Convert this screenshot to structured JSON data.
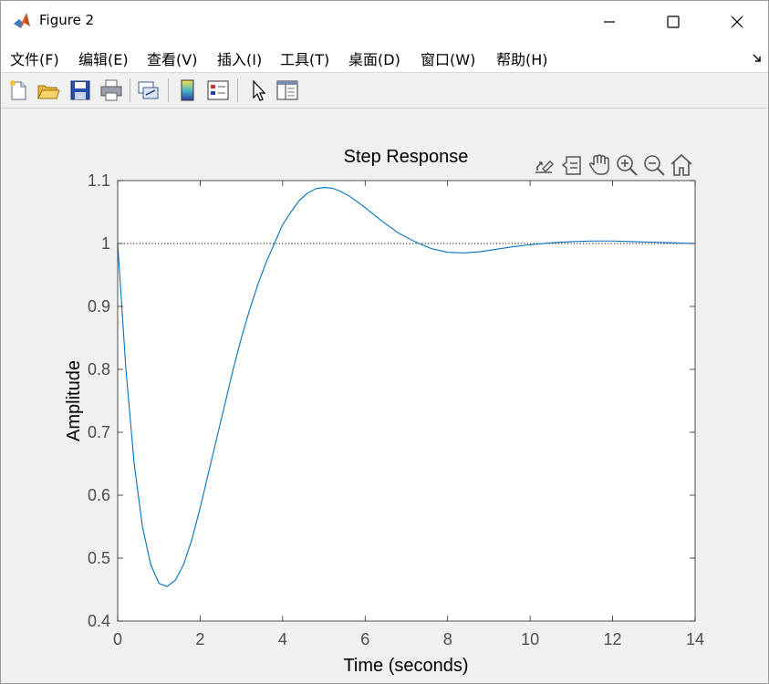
{
  "window": {
    "title": "Figure 2",
    "controls": [
      "minimize",
      "maximize",
      "close"
    ]
  },
  "menubar": {
    "items": [
      {
        "label": "文件(F)"
      },
      {
        "label": "编辑(E)"
      },
      {
        "label": "查看(V)"
      },
      {
        "label": "插入(I)"
      },
      {
        "label": "工具(T)"
      },
      {
        "label": "桌面(D)"
      },
      {
        "label": "窗口(W)"
      },
      {
        "label": "帮助(H)"
      }
    ]
  },
  "toolbar": {
    "buttons": [
      "new-figure-icon",
      "open-file-icon",
      "save-icon",
      "print-icon",
      "link-plot-icon",
      "colorbar-icon",
      "legend-icon",
      "pointer-icon",
      "property-inspector-icon"
    ]
  },
  "axes_toolbar": {
    "buttons": [
      "export-icon",
      "data-tips-icon",
      "pan-hand-icon",
      "zoom-in-icon",
      "zoom-out-icon",
      "home-icon"
    ]
  },
  "colors": {
    "line": "#0072bd",
    "axis": "#262626",
    "tick_label": "#4d4d4d",
    "background": "#f0f0f0"
  },
  "chart_data": {
    "type": "line",
    "title": "Step Response",
    "xlabel": "Time (seconds)",
    "ylabel": "Amplitude",
    "xlim": [
      0,
      14
    ],
    "ylim": [
      0.4,
      1.1
    ],
    "xticks": [
      0,
      2,
      4,
      6,
      8,
      10,
      12,
      14
    ],
    "yticks": [
      0.4,
      0.5,
      0.6,
      0.7,
      0.8,
      0.9,
      1,
      1.1
    ],
    "xtick_labels": [
      "0",
      "2",
      "4",
      "6",
      "8",
      "10",
      "12",
      "14"
    ],
    "ytick_labels": [
      "0.4",
      "0.5",
      "0.6",
      "0.7",
      "0.8",
      "0.9",
      "1",
      "1.1"
    ],
    "grid": false,
    "reference_line": {
      "y": 1,
      "style": "dotted"
    },
    "series": [
      {
        "x": [
          0,
          0.2,
          0.4,
          0.6,
          0.8,
          1.0,
          1.2,
          1.4,
          1.6,
          1.8,
          2.0,
          2.2,
          2.4,
          2.6,
          2.8,
          3.0,
          3.2,
          3.4,
          3.6,
          3.8,
          4.0,
          4.2,
          4.4,
          4.6,
          4.8,
          5.0,
          5.2,
          5.4,
          5.6,
          5.8,
          6.0,
          6.4,
          6.8,
          7.2,
          7.6,
          8.0,
          8.4,
          8.8,
          9.2,
          9.6,
          10.0,
          10.5,
          11.0,
          11.5,
          12.0,
          12.5,
          13.0,
          13.5,
          14.0
        ],
        "values": [
          1.0,
          0.8,
          0.65,
          0.55,
          0.49,
          0.46,
          0.455,
          0.465,
          0.49,
          0.53,
          0.58,
          0.635,
          0.69,
          0.745,
          0.8,
          0.85,
          0.895,
          0.935,
          0.97,
          1.0,
          1.03,
          1.05,
          1.068,
          1.08,
          1.087,
          1.089,
          1.088,
          1.083,
          1.076,
          1.067,
          1.057,
          1.036,
          1.017,
          1.003,
          0.992,
          0.986,
          0.985,
          0.987,
          0.991,
          0.995,
          0.998,
          1.001,
          1.003,
          1.004,
          1.004,
          1.003,
          1.002,
          1.001,
          1.0
        ]
      }
    ]
  }
}
